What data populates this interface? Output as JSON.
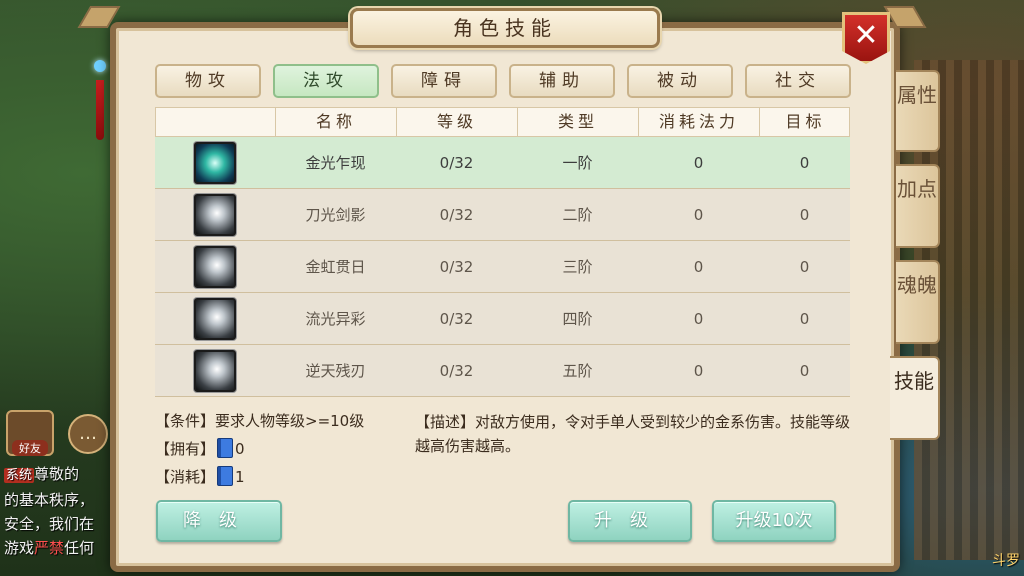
{
  "panel": {
    "title": "角色技能",
    "close_icon": "close-icon"
  },
  "category_tabs": [
    {
      "label": "物攻",
      "active": false
    },
    {
      "label": "法攻",
      "active": true
    },
    {
      "label": "障碍",
      "active": false
    },
    {
      "label": "辅助",
      "active": false
    },
    {
      "label": "被动",
      "active": false
    },
    {
      "label": "社交",
      "active": false
    }
  ],
  "table": {
    "headers": [
      "",
      "名称",
      "等级",
      "类型",
      "消耗法力",
      "目标"
    ],
    "rows": [
      {
        "icon": "blade-light-icon",
        "name": "金光乍现",
        "level": "0/32",
        "type": "一阶",
        "mana": "0",
        "target": "0",
        "selected": true
      },
      {
        "icon": "sword-shadow-icon",
        "name": "刀光剑影",
        "level": "0/32",
        "type": "二阶",
        "mana": "0",
        "target": "0",
        "selected": false
      },
      {
        "icon": "rainbow-sun-icon",
        "name": "金虹贯日",
        "level": "0/32",
        "type": "三阶",
        "mana": "0",
        "target": "0",
        "selected": false
      },
      {
        "icon": "streaming-light-icon",
        "name": "流光异彩",
        "level": "0/32",
        "type": "四阶",
        "mana": "0",
        "target": "0",
        "selected": false
      },
      {
        "icon": "heaven-blade-icon",
        "name": "逆天残刃",
        "level": "0/32",
        "type": "五阶",
        "mana": "0",
        "target": "0",
        "selected": false
      }
    ]
  },
  "info": {
    "condition": "【条件】要求人物等级>=10级",
    "owned_label": "【拥有】",
    "owned_value": "0",
    "cost_label": "【消耗】",
    "cost_value": "1",
    "description": "【描述】对敌方使用，令对手单人受到较少的金系伤害。技能等级越高伤害越高。"
  },
  "buttons": {
    "downgrade": "降级",
    "upgrade": "升级",
    "upgrade10": "升级10次"
  },
  "side_tabs": [
    {
      "label": "属性",
      "active": false
    },
    {
      "label": "加点",
      "active": false
    },
    {
      "label": "魂魄",
      "active": false
    },
    {
      "label": "技能",
      "active": true
    }
  ],
  "hud": {
    "friend_label": "好友",
    "chat_icon": "chat-bubble-icon",
    "chat_lines": [
      {
        "tag": "系统",
        "text": "尊敬的"
      },
      {
        "text": "的基本秩序，"
      },
      {
        "text": "安全，我们在"
      },
      {
        "text": "游戏",
        "red": "严禁",
        "after": "任何"
      }
    ],
    "bottom_right": "斗罗"
  }
}
